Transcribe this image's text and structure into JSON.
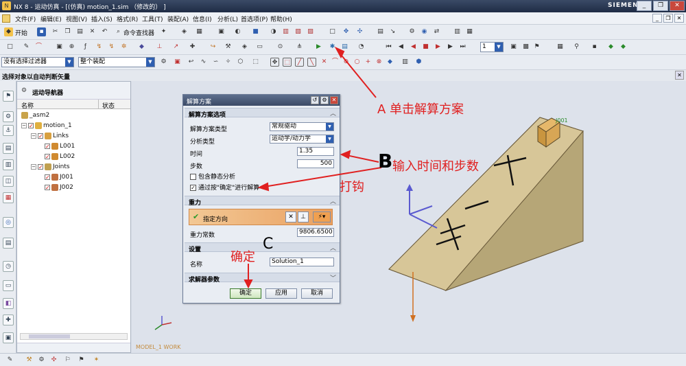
{
  "window": {
    "title": "NX 8 - 运动仿真 - [(仿真) motion_1.sim （修改的） ]",
    "brand": "SIEMENS",
    "buttons": [
      "_",
      "❐",
      "✕"
    ],
    "doc_buttons": [
      "_",
      "❐",
      "✕"
    ]
  },
  "menubar": {
    "items": [
      "文件(F)",
      "编辑(E)",
      "视图(V)",
      "插入(S)",
      "格式(R)",
      "工具(T)",
      "装配(A)",
      "信息(I)",
      "分析(L)",
      "首选项(P)",
      "帮助(H)"
    ]
  },
  "toolbar1": {
    "start_label": "开始",
    "command_finder_label": "命令查找器"
  },
  "toolbar2": {
    "frame_value": "1"
  },
  "toolbar3": {
    "filter_value": "没有选择过滤器",
    "assembly_value": "整个装配"
  },
  "status": {
    "message": "选择对象以自动判断矢量"
  },
  "navigator": {
    "title": "运动导航器",
    "col_name": "名称",
    "col_status": "状态",
    "nodes": [
      {
        "label": "_asm2"
      },
      {
        "label": "motion_1"
      },
      {
        "label": "Links"
      },
      {
        "label": "L001"
      },
      {
        "label": "L002"
      },
      {
        "label": "Joints"
      },
      {
        "label": "J001"
      },
      {
        "label": "J002"
      }
    ]
  },
  "dialog": {
    "title": "解算方案",
    "sections": {
      "options": "解算方案选项",
      "gravity": "重力",
      "settings": "设置",
      "solver": "求解器参数"
    },
    "fields": {
      "type_label": "解算方案类型",
      "type_value": "常规驱动",
      "analysis_label": "分析类型",
      "analysis_value": "运动学/动力学",
      "time_label": "时间",
      "time_value": "1.35",
      "steps_label": "步数",
      "steps_value": "500",
      "static_label": "包含静态分析",
      "static_checked": false,
      "ok_solve_label": "通过按\"确定\"进行解算",
      "ok_solve_checked": true,
      "direction_label": "指定方向",
      "gravity_const_label": "重力常数",
      "gravity_const_value": "9806.6500",
      "name_label": "名称",
      "name_value": "Solution_1"
    },
    "buttons": {
      "ok": "确定",
      "apply": "应用",
      "cancel": "取消"
    }
  },
  "model": {
    "label_part": "J001",
    "model_label": "MODEL_1 WORK"
  },
  "annotations": {
    "a_text": "A 单击解算方案",
    "b_mark": "B",
    "b_text": "输入时间和步数",
    "tick_text": "打钩",
    "c_mark": "C",
    "ok_text": "确定",
    "color": "#e02020"
  }
}
